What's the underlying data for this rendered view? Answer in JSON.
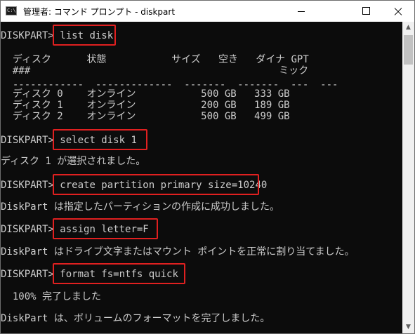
{
  "window": {
    "title": "管理者: コマンド プロンプト - diskpart",
    "icon_text": "C:\\"
  },
  "controls": {
    "minimize": "minimize",
    "maximize": "maximize",
    "close": "close"
  },
  "console": {
    "prompt1": "DISKPART> ",
    "cmd1": "list disk",
    "header1": "  ディスク      状態           サイズ   空き   ダイナ GPT",
    "header2": "  ###                                          ミック",
    "separator": "  ------------  -------------  -------  -------  ---  ---",
    "disks": [
      "  ディスク 0    オンライン           500 GB   333 GB",
      "  ディスク 1    オンライン           200 GB   189 GB",
      "  ディスク 2    オンライン           500 GB   499 GB"
    ],
    "prompt2": "DISKPART> ",
    "cmd2": "select disk 1",
    "out2": "ディスク 1 が選択されました。",
    "prompt3": "DISKPART> ",
    "cmd3": "create partition primary size=10240",
    "out3": "DiskPart は指定したパーティションの作成に成功しました。",
    "prompt4": "DISKPART> ",
    "cmd4": "assign letter=F",
    "out4": "DiskPart はドライブ文字またはマウント ポイントを正常に割り当てました。",
    "prompt5": "DISKPART> ",
    "cmd5": "format fs=ntfs quick",
    "out5a": "  100% 完了しました",
    "out5b": "DiskPart は、ボリュームのフォーマットを完了しました。"
  },
  "colors": {
    "highlight": "#e02020",
    "console_bg": "#0c0c0c",
    "console_fg": "#cccccc"
  }
}
